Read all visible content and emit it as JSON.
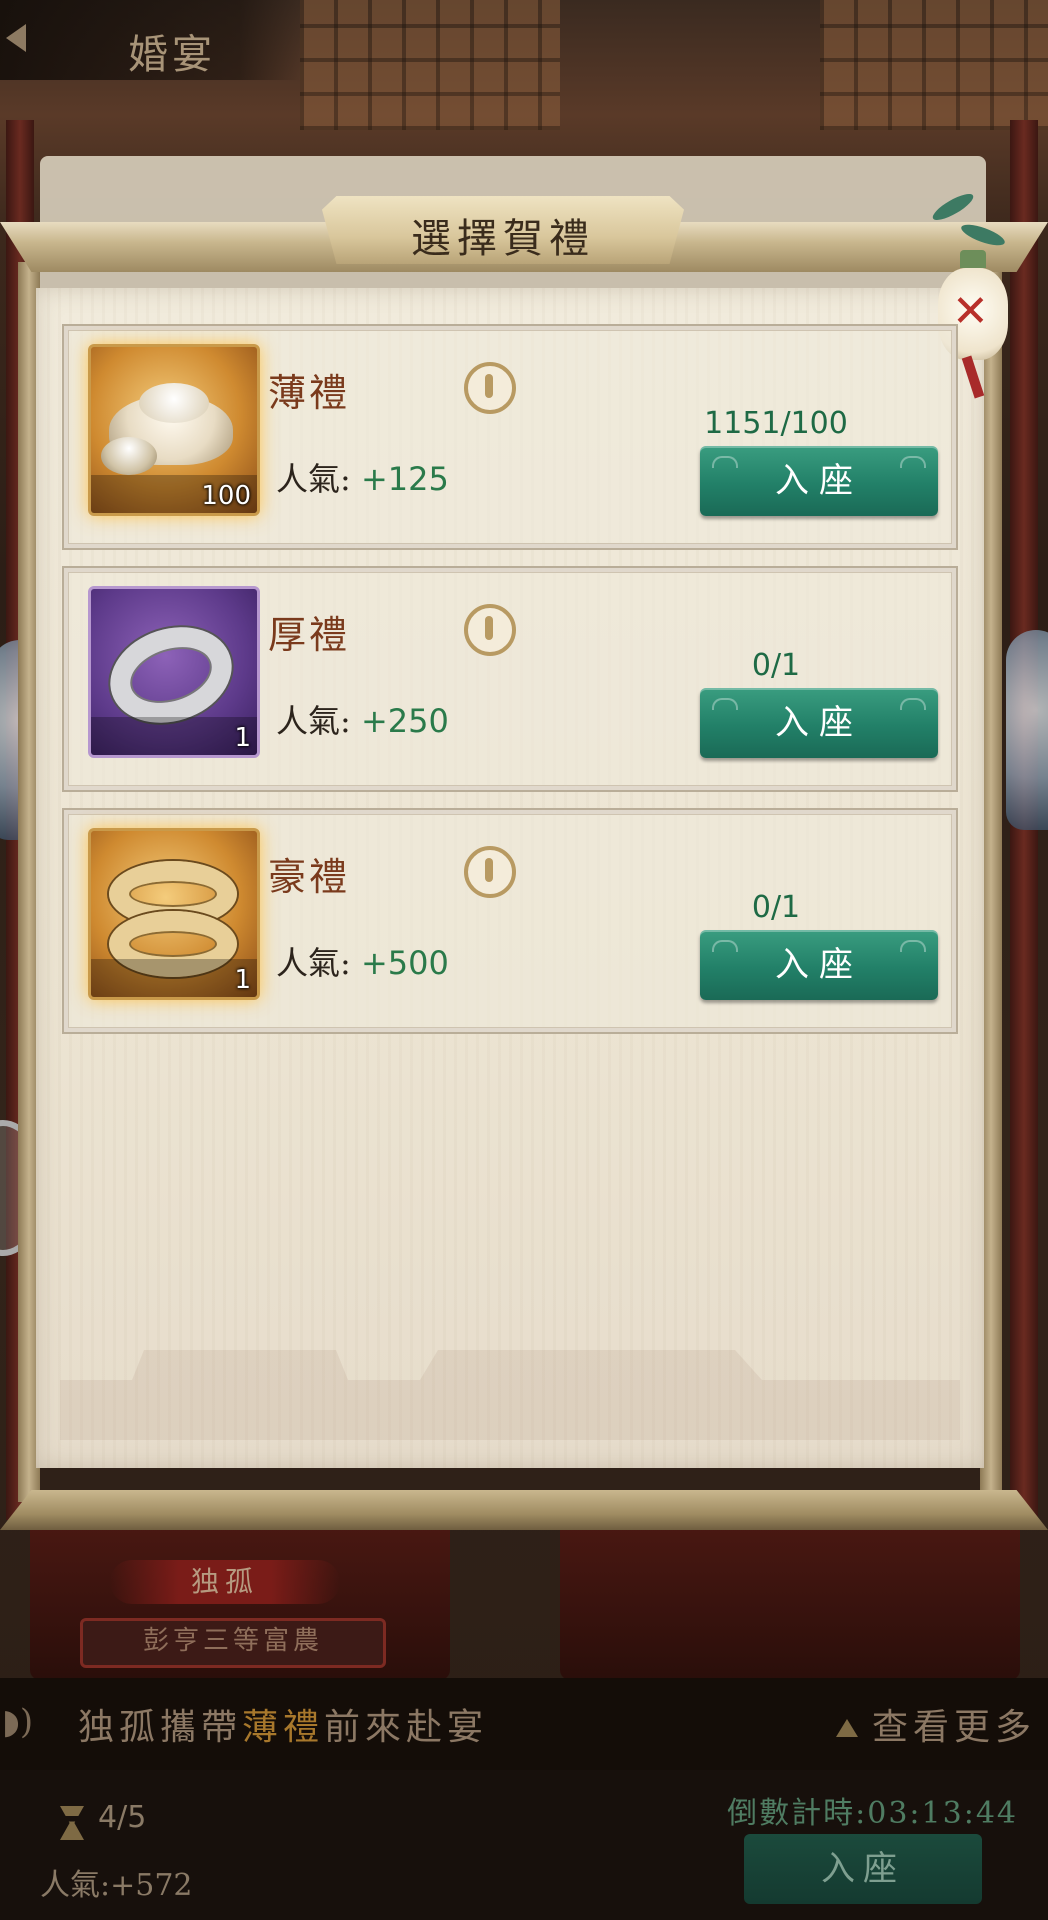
{
  "header": {
    "title": "婚宴"
  },
  "modal": {
    "title": "選擇賀禮",
    "gifts": [
      {
        "name": "薄禮",
        "qty": "100",
        "pop_label": "人氣:",
        "pop_value": "+125",
        "count": "1151/100",
        "button": "入座",
        "frame": "gold",
        "icon": "silver-ingot-icon"
      },
      {
        "name": "厚禮",
        "qty": "1",
        "pop_label": "人氣:",
        "pop_value": "+250",
        "count": "0/1",
        "button": "入座",
        "frame": "purple",
        "icon": "silver-bracelet-icon"
      },
      {
        "name": "豪禮",
        "qty": "1",
        "pop_label": "人氣:",
        "pop_value": "+500",
        "count": "0/1",
        "button": "入座",
        "frame": "gold",
        "icon": "gold-bracelets-icon"
      }
    ]
  },
  "background": {
    "guest_name": "独孤",
    "guest_title": "彭亨三等富農",
    "ticker": {
      "before": "独孤攜帶",
      "highlight": "薄禮",
      "after": "前來赴宴"
    },
    "view_more": "查看更多",
    "seats": "4/5",
    "total_popularity": "人氣:+572",
    "countdown": "倒數計時:03:13:44",
    "join_button": "入座"
  },
  "colors": {
    "accent_green": "#228068",
    "value_green": "#2a7a4a",
    "gift_name": "#7a3a1c"
  }
}
